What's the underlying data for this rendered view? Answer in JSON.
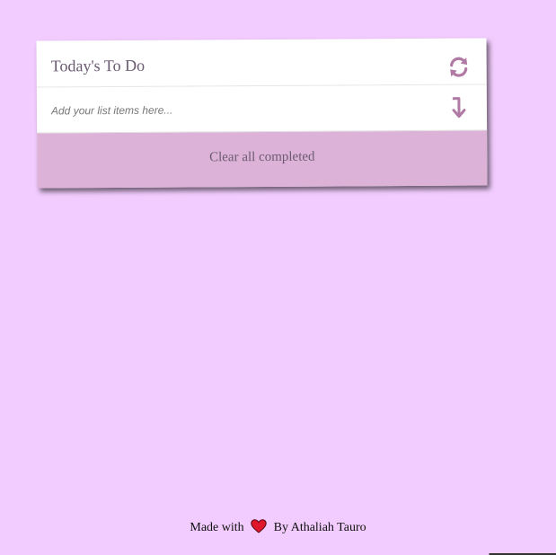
{
  "todo": {
    "title": "Today's To Do",
    "input_placeholder": "Add your list items here...",
    "input_value": "",
    "clear_label": "Clear all completed",
    "refresh_icon": "refresh-icon",
    "add_icon": "arrow-down-turn-icon"
  },
  "footer": {
    "prefix": "Made with",
    "icon": "heart-icon",
    "suffix": "By Athaliah Tauro"
  },
  "colors": {
    "background": "#f2ccfe",
    "accent": "#ddb2d9",
    "icon": "#b07aa4",
    "heart": "#e0162b"
  }
}
